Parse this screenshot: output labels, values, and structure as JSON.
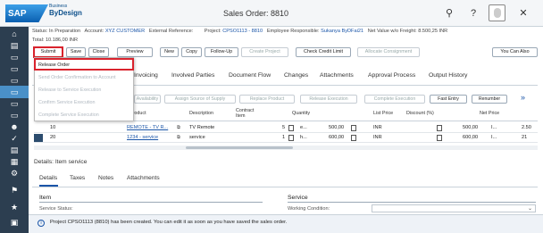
{
  "header": {
    "brand": "SAP",
    "brand_sub": "Business",
    "brand_product": "ByDesign",
    "title": "Sales Order: 8810"
  },
  "sidebar": {
    "icons": [
      "home-icon",
      "inbox-icon",
      "doc-icon",
      "doc-icon",
      "doc-icon",
      "doc-icon",
      "doc-icon",
      "doc-icon",
      "people-icon",
      "ok-icon",
      "chart-icon",
      "calendar-icon",
      "gear-icon",
      "flag-icon",
      "star-icon",
      "briefcase-icon"
    ]
  },
  "info": {
    "status_label": "Status:",
    "status_value": "In Preparation",
    "account_label": "Account:",
    "account_value": "XYZ CUSTOMER",
    "extref_label": "External Reference:",
    "project_label": "Project:",
    "project_value": "CPSO1113 - 8810",
    "employee_label": "Employee Responsible:",
    "employee_value": "Sukanya ByDFai21",
    "netvalue_label": "Net Value w/o Freight:",
    "netvalue_value": "8.500,25 INR",
    "total_label": "Total:",
    "total_value": "10.186,00 INR"
  },
  "toolbar": {
    "submit": "Submit",
    "save": "Save",
    "close": "Close",
    "preview": "Preview",
    "new": "New",
    "copy": "Copy",
    "follow_up": "Follow-Up",
    "create_project": "Create Project",
    "check_credit": "Check Credit Limit",
    "allocate": "Allocate Consignment",
    "you_can_also": "You Can Also"
  },
  "submit_menu": {
    "items": [
      "Release Order",
      "Send Order Confirmation to Account",
      "Release to Service Execution",
      "Confirm Service Execution",
      "Complete Service Execution"
    ]
  },
  "tabs": [
    "Invoicing",
    "Involved Parties",
    "Document Flow",
    "Changes",
    "Attachments",
    "Approval Process",
    "Output History"
  ],
  "table_toolbar": {
    "availability": "Availability",
    "assign_source": "Assign Source of Supply",
    "replace_product": "Replace Product",
    "release_execution": "Release Execution",
    "complete_execution": "Complete Execution",
    "fast_entry": "Fast Entry",
    "renumber": "Renumber"
  },
  "table": {
    "headers": {
      "product": "Product",
      "description": "Description",
      "contract_item": "Contract Item",
      "quantity": "Quantity",
      "list_price": "List Price",
      "discount": "Discount (%)",
      "net_price": "Net Price"
    },
    "rows": [
      {
        "item": "10",
        "product": "REMOTE - TV R...",
        "description": "TV Remote",
        "qty": "5",
        "qty_unit": "e...",
        "amount": "500,00",
        "currency": "INR",
        "list_price": "500,00",
        "lp_unit": "I...",
        "net": "2.50"
      },
      {
        "item": "20",
        "product": "1234 - service",
        "description": "service",
        "qty": "1",
        "qty_unit": "h...",
        "amount": "600,00",
        "currency": "INR",
        "list_price": "600,00",
        "lp_unit": "I...",
        "net": "21"
      }
    ]
  },
  "details": {
    "title": "Details: Item service",
    "tabs": [
      "Details",
      "Taxes",
      "Notes",
      "Attachments"
    ],
    "section_item": "Item",
    "section_service": "Service",
    "service_status_label": "Service Status:",
    "working_condition_label": "Working Condition:"
  },
  "message": {
    "text": "Project CPSO1113 (8810) has been created. You can edit it as soon as you have saved the sales order."
  },
  "colors": {
    "sidebar": "#2c3e50",
    "link": "#1a55a8",
    "highlight_box": "#d9232d"
  }
}
